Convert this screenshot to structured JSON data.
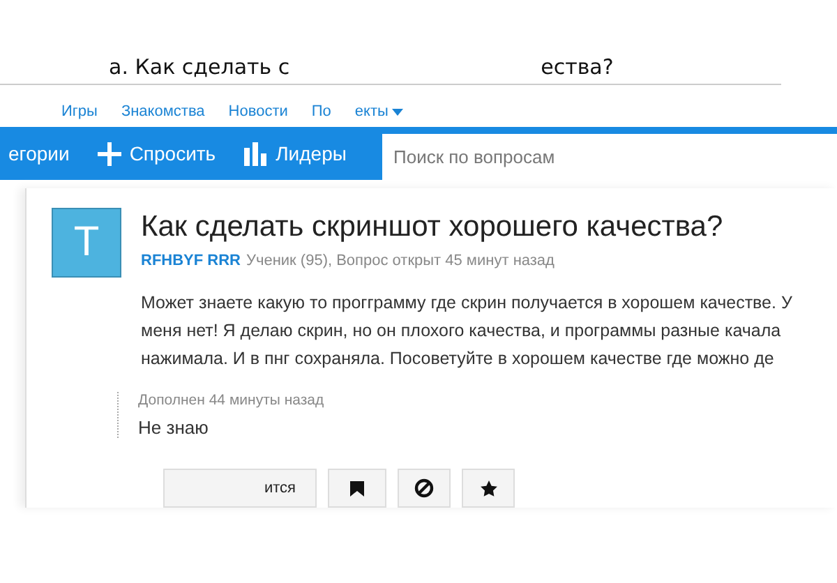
{
  "page_title": {
    "left": "а. Как сделать с",
    "right": "ества?"
  },
  "nav": [
    {
      "label": "Игры"
    },
    {
      "label": "Знакомства"
    },
    {
      "label": "Новости"
    },
    {
      "label": "По"
    },
    {
      "label": "екты",
      "dropdown": true
    }
  ],
  "toolbar": {
    "items": [
      {
        "kind": "text",
        "label": "егории"
      },
      {
        "kind": "plus",
        "label": "Спросить"
      },
      {
        "kind": "bars",
        "label": "Лидеры"
      }
    ],
    "search": {
      "placeholder": "Поиск по вопросам"
    }
  },
  "question": {
    "avatar_letter": "T",
    "title": "Как сделать скриншот хорошего качества?",
    "author": "RFHBYF RRR",
    "meta": "Ученик (95), Вопрос открыт 45 минут назад",
    "body": "Может знаете какую то прогграмму где скрин получается в хорошем качестве. У меня нет! Я делаю скрин, но он плохого качества, и программы разные качала нажимала. И в пнг сохраняла. Посоветуйте в хорошем качестве где можно де",
    "addition": {
      "time": "Дополнен 44 минуты назад",
      "text": "Не знаю"
    }
  },
  "actions": [
    {
      "kind": "text",
      "label": "ится"
    },
    {
      "kind": "flag"
    },
    {
      "kind": "ban"
    },
    {
      "kind": "star"
    }
  ]
}
